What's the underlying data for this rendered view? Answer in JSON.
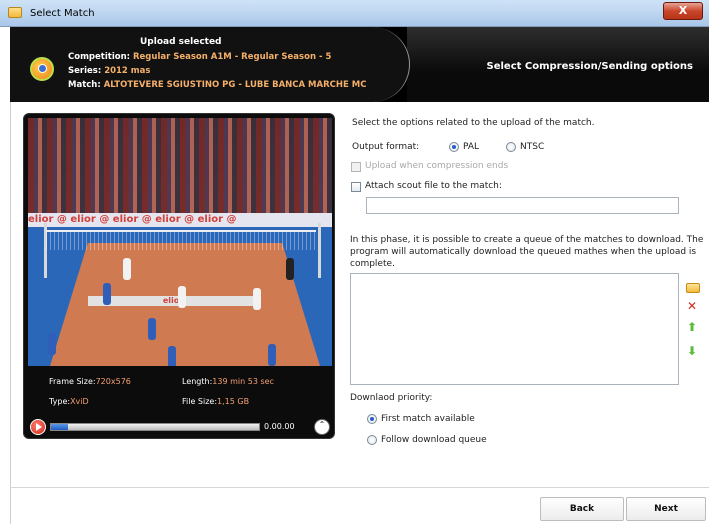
{
  "window": {
    "title": "Select Match",
    "close_label": "X"
  },
  "header": {
    "title": "Upload selected",
    "competition_label": "Competition:",
    "competition_value": "Regular Season A1M - Regular Season - 5",
    "series_label": "Series:",
    "series_value": "2012 mas",
    "match_label": "Match:",
    "match_value": "ALTOTEVERE SGIUSTINO PG - LUBE BANCA MARCHE MC",
    "step_title": "Select Compression/Sending options"
  },
  "player": {
    "banner_text": "elior @ elior @ elior @ elior @ elior @",
    "court_text": "elior",
    "frame_size_label": "Frame Size:",
    "frame_size_value": "720x576",
    "length_label": "Length:",
    "length_value": "139 min 53 sec",
    "type_label": "Type:",
    "type_value": "XviD",
    "file_size_label": "File Size:",
    "file_size_value": "1,15 GB",
    "time": "0.00.00",
    "progress": 0.08
  },
  "options": {
    "intro": "Select the options related to the upload of the match.",
    "output_format_label": "Output format:",
    "pal_label": "PAL",
    "ntsc_label": "NTSC",
    "output_format_selected": "PAL",
    "upload_when_compression_label": "Upload when compression ends",
    "attach_scout_label": "Attach scout file to the match:",
    "scout_file_value": "",
    "queue_info_1": "In this phase, it is possible to create a queue of the matches to download. The",
    "queue_info_2": "program will automatically download the queued mathes when the upload is",
    "queue_info_3": "complete.",
    "priority_label": "Downlaod priority:",
    "first_match_label": "First match available",
    "follow_queue_label": "Follow download queue",
    "priority_selected": "First match available"
  },
  "footer": {
    "back_label": "Back",
    "next_label": "Next"
  },
  "colors": {
    "accent_text": "#f4b06a",
    "header_bg": "#000000",
    "close_red": "#c9462c"
  }
}
